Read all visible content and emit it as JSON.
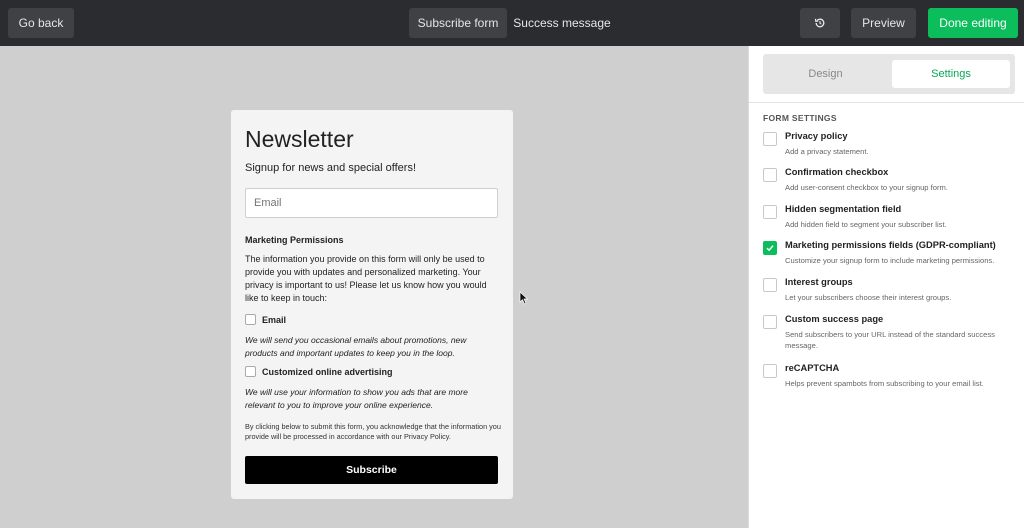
{
  "topbar": {
    "go_back": "Go back",
    "tabs": [
      {
        "label": "Subscribe form",
        "active": true
      },
      {
        "label": "Success message",
        "active": false
      }
    ],
    "preview": "Preview",
    "done": "Done editing",
    "undo_icon": "history-icon"
  },
  "form": {
    "title": "Newsletter",
    "subtitle": "Signup for news and special offers!",
    "email_placeholder": "Email",
    "mp_title": "Marketing Permissions",
    "mp_text": "The information you provide on this form will only be used to provide you with updates and personalized marketing. Your privacy is important to us! Please let us know how you would like to keep in touch:",
    "options": [
      {
        "label": "Email",
        "desc": "We will send you occasional emails about promotions, new products and important updates to keep you in the loop."
      },
      {
        "label": "Customized online advertising",
        "desc": "We will use your information to show you ads that are more relevant to you to improve your online experience."
      }
    ],
    "legal": "By clicking below to submit this form, you acknowledge that the information you provide will be processed in accordance with our Privacy Policy.",
    "subscribe": "Subscribe"
  },
  "panel": {
    "tabs": {
      "design": "Design",
      "settings": "Settings"
    },
    "section_title": "FORM SETTINGS",
    "settings": [
      {
        "label": "Privacy policy",
        "desc": "Add a privacy statement.",
        "checked": false
      },
      {
        "label": "Confirmation checkbox",
        "desc": "Add user-consent checkbox to your signup form.",
        "checked": false
      },
      {
        "label": "Hidden segmentation field",
        "desc": "Add hidden field to segment your subscriber list.",
        "checked": false
      },
      {
        "label": "Marketing permissions fields (GDPR-compliant)",
        "desc": "Customize your signup form to include marketing permissions.",
        "checked": true
      },
      {
        "label": "Interest groups",
        "desc": "Let your subscribers choose their interest groups.",
        "checked": false
      },
      {
        "label": "Custom success page",
        "desc": "Send subscribers to your URL instead of the standard success message.",
        "checked": false
      },
      {
        "label": "reCAPTCHA",
        "desc": "Helps prevent spambots from subscribing to your email list.",
        "checked": false
      }
    ]
  },
  "colors": {
    "accent": "#0cbd5c",
    "topbar_bg": "#2b2c2f"
  }
}
